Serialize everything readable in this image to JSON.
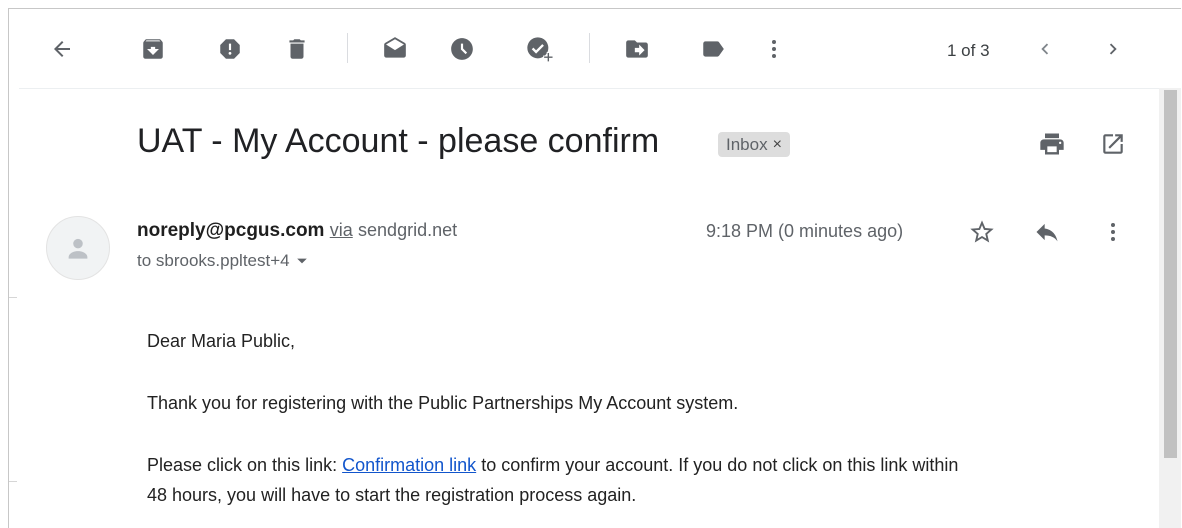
{
  "toolbar": {
    "icons": [
      "back-arrow-icon",
      "archive-icon",
      "report-spam-icon",
      "delete-icon",
      "mark-unread-icon",
      "snooze-icon",
      "add-to-tasks-icon",
      "move-to-icon",
      "label-icon",
      "more-vert-icon"
    ],
    "pagination": "1 of 3"
  },
  "email": {
    "subject": "UAT - My Account - please confirm",
    "label": "Inbox",
    "label_remove": "×",
    "sender_email": "noreply@pcgus.com",
    "via_text": "via",
    "via_domain": "sendgrid.net",
    "to_text": "to sbrooks.ppltest+4",
    "time": "9:18 PM (0 minutes ago)",
    "body": {
      "greeting": "Dear Maria Public,",
      "line1": "Thank you for registering with the Public Partnerships My Account system.",
      "line2_before": "Please click on this link:",
      "link_text": "Confirmation link",
      "line2_after": "to confirm your account. If you do not click on this link within",
      "line3": "48 hours, you will have to start the registration process again."
    }
  },
  "colors": {
    "icon": "#5f6368",
    "link": "#1155cc",
    "chip_bg": "#dddddd"
  }
}
